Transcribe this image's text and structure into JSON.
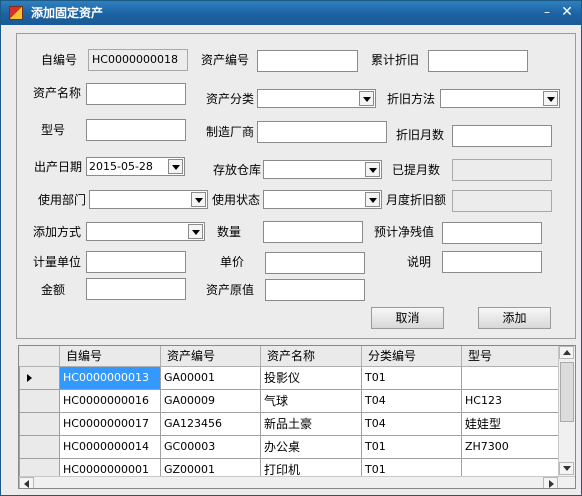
{
  "window": {
    "title": "添加固定资产",
    "minimize_label": "–",
    "close_label": "✕",
    "title_color": "#1c62a2"
  },
  "form": {
    "auto_id": {
      "label": "自编号",
      "value": "HC0000000018"
    },
    "asset_code": {
      "label": "资产编号",
      "value": ""
    },
    "accum_depr": {
      "label": "累计折旧",
      "value": ""
    },
    "asset_name": {
      "label": "资产名称",
      "value": ""
    },
    "asset_category": {
      "label": "资产分类",
      "value": ""
    },
    "depr_method": {
      "label": "折旧方法",
      "value": ""
    },
    "model": {
      "label": "型号",
      "value": ""
    },
    "manufacturer": {
      "label": "制造厂商",
      "value": ""
    },
    "depr_months": {
      "label": "折旧月数",
      "value": ""
    },
    "prod_date": {
      "label": "出产日期",
      "value": "2015-05-28"
    },
    "warehouse": {
      "label": "存放仓库",
      "value": ""
    },
    "months_accrued": {
      "label": "已提月数",
      "value": ""
    },
    "department": {
      "label": "使用部门",
      "value": ""
    },
    "use_status": {
      "label": "使用状态",
      "value": ""
    },
    "monthly_depr": {
      "label": "月度折旧额",
      "value": ""
    },
    "add_method": {
      "label": "添加方式",
      "value": ""
    },
    "quantity": {
      "label": "数量",
      "value": ""
    },
    "est_residual": {
      "label": "预计净残值",
      "value": ""
    },
    "unit": {
      "label": "计量单位",
      "value": ""
    },
    "unit_price": {
      "label": "单价",
      "value": ""
    },
    "remark": {
      "label": "说明",
      "value": ""
    },
    "amount": {
      "label": "金额",
      "value": ""
    },
    "original_value": {
      "label": "资产原值",
      "value": ""
    }
  },
  "buttons": {
    "cancel": "取消",
    "add": "添加"
  },
  "grid": {
    "columns": [
      "自编号",
      "资产编号",
      "资产名称",
      "分类编号",
      "型号"
    ],
    "rows": [
      [
        "HC0000000013",
        "GA00001",
        "投影仪",
        "T01",
        ""
      ],
      [
        "HC0000000016",
        "GA00009",
        "气球",
        "T04",
        "HC123"
      ],
      [
        "HC0000000017",
        "GA123456",
        "新品土豪",
        "T04",
        "娃娃型"
      ],
      [
        "HC0000000014",
        "GC00003",
        "办公桌",
        "T01",
        "ZH7300"
      ],
      [
        "HC0000000001",
        "GZ00001",
        "打印机",
        "T01",
        ""
      ]
    ],
    "selected_row": 0
  },
  "icons": {
    "app": "app-icon",
    "dropdown": "dropdown-arrow-icon",
    "row_pointer": "row-pointer-icon"
  }
}
